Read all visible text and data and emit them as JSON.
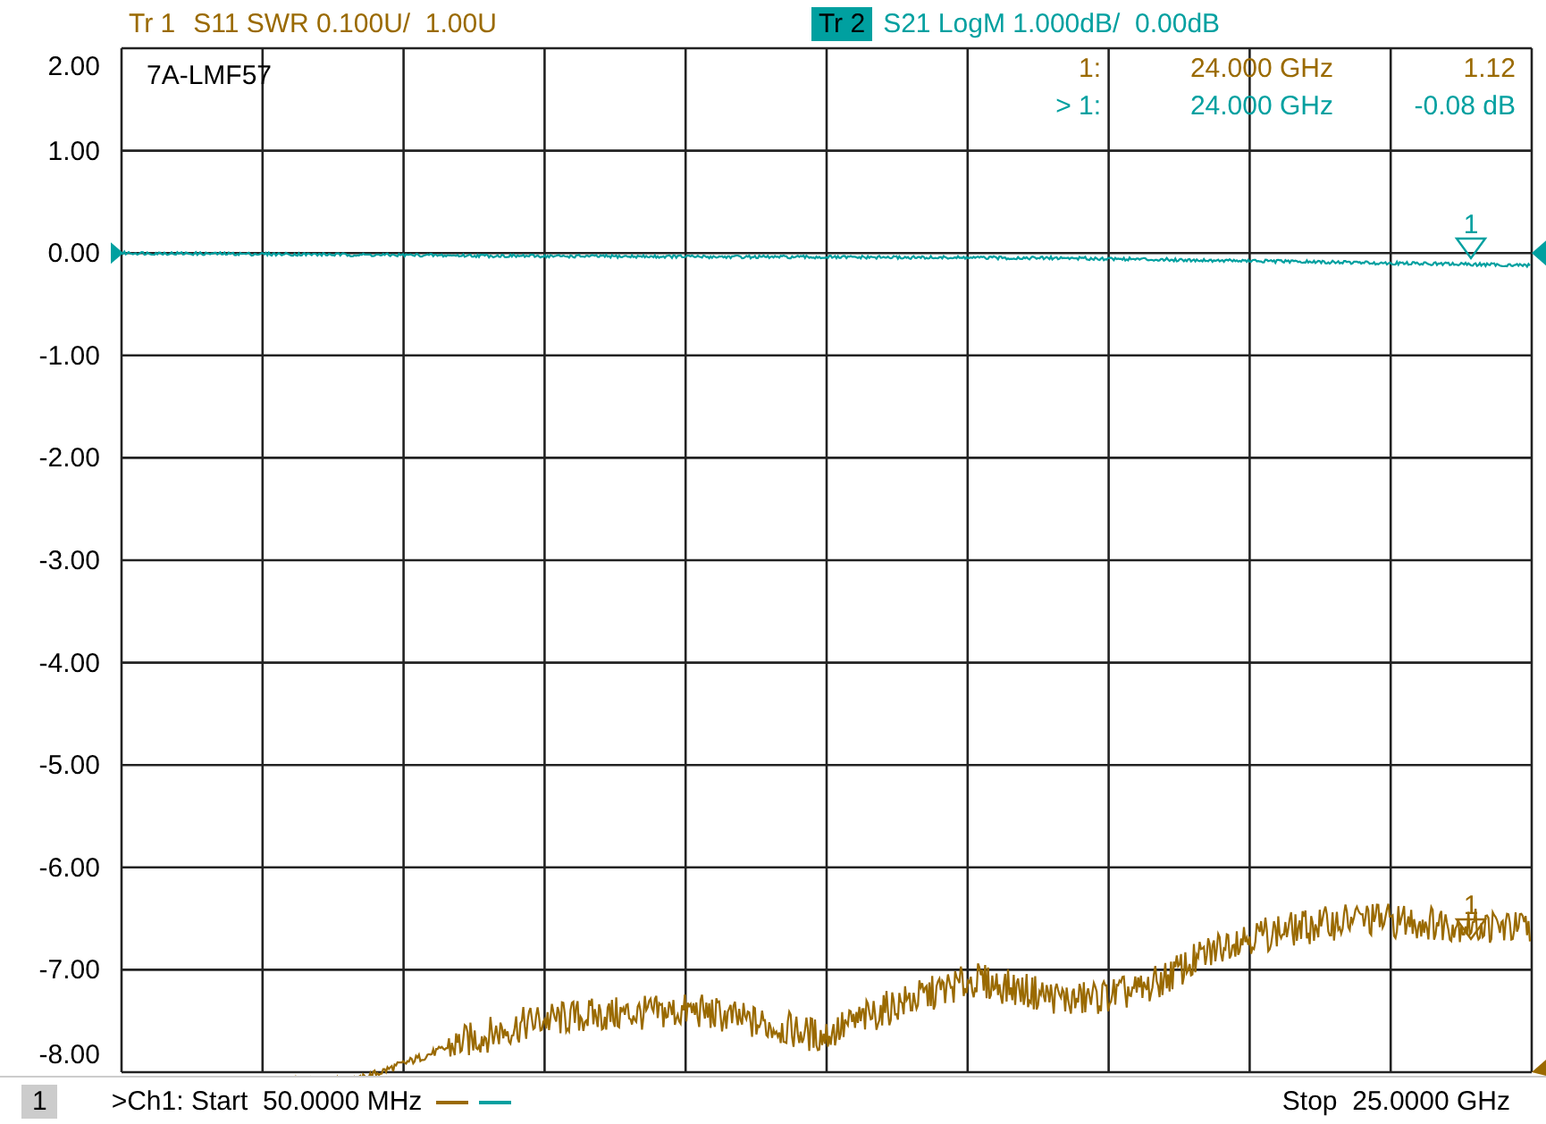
{
  "header": {
    "traces": [
      {
        "label": "Tr 1",
        "text": "S11 SWR 0.100U/  1.00U",
        "selected": false,
        "color": "#9a6a00"
      },
      {
        "label": "Tr 2",
        "text": "S21 LogM 1.000dB/  0.00dB",
        "selected": true,
        "color": "#00a0a0"
      }
    ]
  },
  "trace_markers": [
    {
      "label": "1",
      "color": "#00a0a0"
    },
    {
      "label": "1",
      "color": "#9a6a00"
    }
  ],
  "plot": {
    "title": "7A-LMF57",
    "y_labels": [
      "2.00",
      "1.00",
      "0.00",
      "-1.00",
      "-2.00",
      "-3.00",
      "-4.00",
      "-5.00",
      "-6.00",
      "-7.00",
      "-8.00"
    ],
    "readouts": [
      {
        "number": "1:",
        "frequency": "24.000 GHz",
        "value": "1.12",
        "color": "#9a6a00"
      },
      {
        "number": "> 1:",
        "frequency": "24.000 GHz",
        "value": "-0.08 dB",
        "color": "#00a0a0"
      }
    ]
  },
  "footer": {
    "channel": "1",
    "start": ">Ch1: Start  50.0000 MHz",
    "stop": "Stop  25.0000 GHz"
  }
}
